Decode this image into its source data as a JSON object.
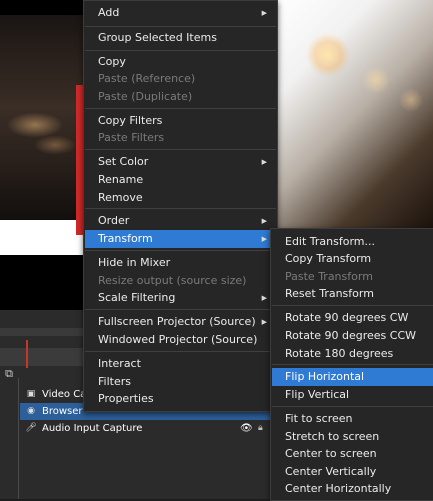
{
  "main_menu": {
    "items": [
      {
        "label": "Add",
        "submenu": true
      },
      {
        "label": "Group Selected Items"
      },
      {
        "label": "Copy"
      },
      {
        "label": "Paste (Reference)",
        "disabled": true
      },
      {
        "label": "Paste (Duplicate)",
        "disabled": true
      },
      {
        "label": "Copy Filters"
      },
      {
        "label": "Paste Filters",
        "disabled": true
      },
      {
        "label": "Set Color",
        "submenu": true
      },
      {
        "label": "Rename"
      },
      {
        "label": "Remove"
      },
      {
        "label": "Order",
        "submenu": true
      },
      {
        "label": "Transform",
        "submenu": true,
        "active": true
      },
      {
        "label": "Hide in Mixer"
      },
      {
        "label": "Resize output (source size)",
        "disabled": true
      },
      {
        "label": "Scale Filtering",
        "submenu": true
      },
      {
        "label": "Fullscreen Projector (Source)",
        "submenu": true
      },
      {
        "label": "Windowed Projector (Source)"
      },
      {
        "label": "Interact"
      },
      {
        "label": "Filters"
      },
      {
        "label": "Properties"
      }
    ]
  },
  "transform_menu": {
    "items": [
      {
        "label": "Edit Transform..."
      },
      {
        "label": "Copy Transform"
      },
      {
        "label": "Paste Transform",
        "disabled": true
      },
      {
        "label": "Reset Transform"
      },
      {
        "label": "Rotate 90 degrees CW"
      },
      {
        "label": "Rotate 90 degrees CCW"
      },
      {
        "label": "Rotate 180 degrees"
      },
      {
        "label": "Flip Horizontal",
        "active": true
      },
      {
        "label": "Flip Vertical"
      },
      {
        "label": "Fit to screen"
      },
      {
        "label": "Stretch to screen"
      },
      {
        "label": "Center to screen"
      },
      {
        "label": "Center Vertically"
      },
      {
        "label": "Center Horizontally"
      }
    ]
  },
  "sources": [
    {
      "name": "Video Cap",
      "icon": "camera-icon"
    },
    {
      "name": "Browser",
      "icon": "browser-icon",
      "selected": true
    },
    {
      "name": "Audio Input Capture",
      "icon": "microphone-icon",
      "visible": true,
      "locked": true
    }
  ],
  "colors": {
    "menu_bg": "#262626",
    "highlight": "#2f7ad3",
    "disabled_text": "#7a7a7a",
    "selection_bg": "#2d5f9a"
  }
}
